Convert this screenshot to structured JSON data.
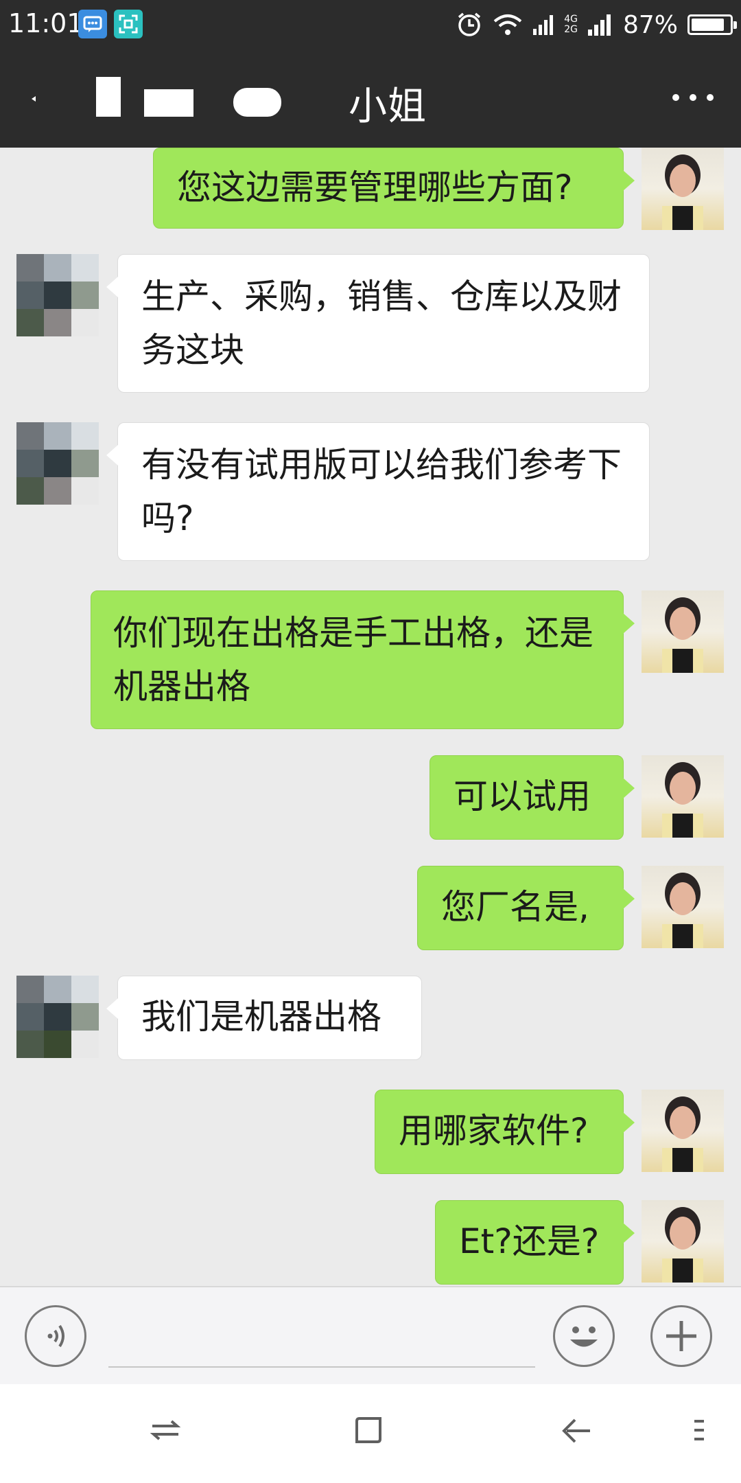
{
  "status_bar": {
    "time": "11:01",
    "network_top": "4G",
    "network_bottom": "2G",
    "battery_percent": "87%",
    "battery_level": 0.87,
    "icons": [
      "message-notification-icon",
      "scan-notification-icon",
      "alarm-icon",
      "wifi-icon",
      "signal-icon",
      "battery-icon"
    ]
  },
  "header": {
    "title": "小姐",
    "back_icon": "chevron-left-icon",
    "more_icon": "more-icon"
  },
  "messages": [
    {
      "from": "me",
      "text": "您这边需要管理哪些方面?"
    },
    {
      "from": "them",
      "text": "生产、采购，销售、仓库以及财务这块"
    },
    {
      "from": "them",
      "text": "有没有试用版可以给我们参考下吗?"
    },
    {
      "from": "me",
      "text": "你们现在出格是手工出格，还是机器出格"
    },
    {
      "from": "me",
      "text": "可以试用"
    },
    {
      "from": "me",
      "text": "您厂名是,"
    },
    {
      "from": "them",
      "text": "我们是机器出格"
    },
    {
      "from": "me",
      "text": "用哪家软件?"
    },
    {
      "from": "me",
      "text": "Et?还是?"
    }
  ],
  "colors": {
    "bar_dark": "#2c2c2c",
    "chat_bg": "#ebebeb",
    "outgoing_bubble": "#a0e75a",
    "incoming_bubble": "#ffffff"
  },
  "input_bar": {
    "voice_icon": "voice-icon",
    "emoji_icon": "emoji-icon",
    "plus_icon": "plus-icon"
  },
  "nav_bar": {
    "icons": [
      "switch-icon",
      "home-square-icon",
      "back-arrow-icon",
      "menu-icon"
    ]
  }
}
